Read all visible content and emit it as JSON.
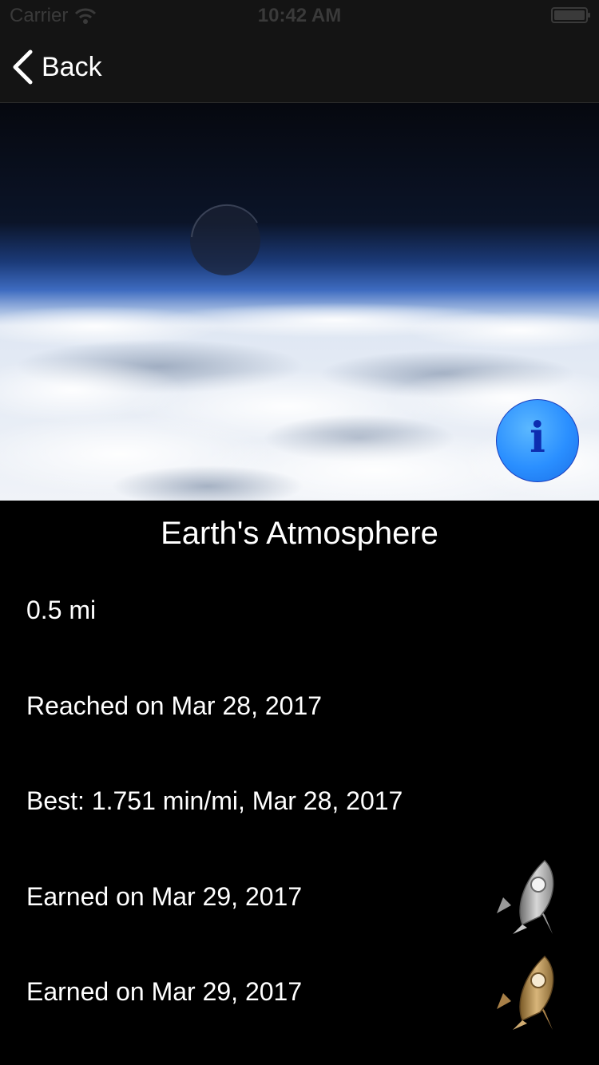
{
  "status_bar": {
    "carrier": "Carrier",
    "time": "10:42 AM",
    "wifi_icon": "wifi-icon",
    "battery_icon": "battery-icon"
  },
  "nav": {
    "back_label": "Back",
    "back_icon": "chevron-left-icon"
  },
  "hero": {
    "image": "earth-atmosphere-photo",
    "info_icon": "info-icon",
    "info_glyph": "i"
  },
  "detail": {
    "title": "Earth's Atmosphere",
    "distance": "0.5 mi",
    "reached": "Reached on Mar 28, 2017",
    "best": "Best: 1.751 min/mi, Mar 28, 2017",
    "badges": [
      {
        "label": "Earned on Mar 29, 2017",
        "icon": "rocket-silver-icon",
        "color": "#c8c8c8"
      },
      {
        "label": "Earned on Mar 29, 2017",
        "icon": "rocket-gold-icon",
        "color": "#b08a50"
      }
    ]
  },
  "colors": {
    "background": "#000000",
    "bar": "#141414",
    "info_button": "#2a8fff",
    "text": "#ffffff"
  }
}
